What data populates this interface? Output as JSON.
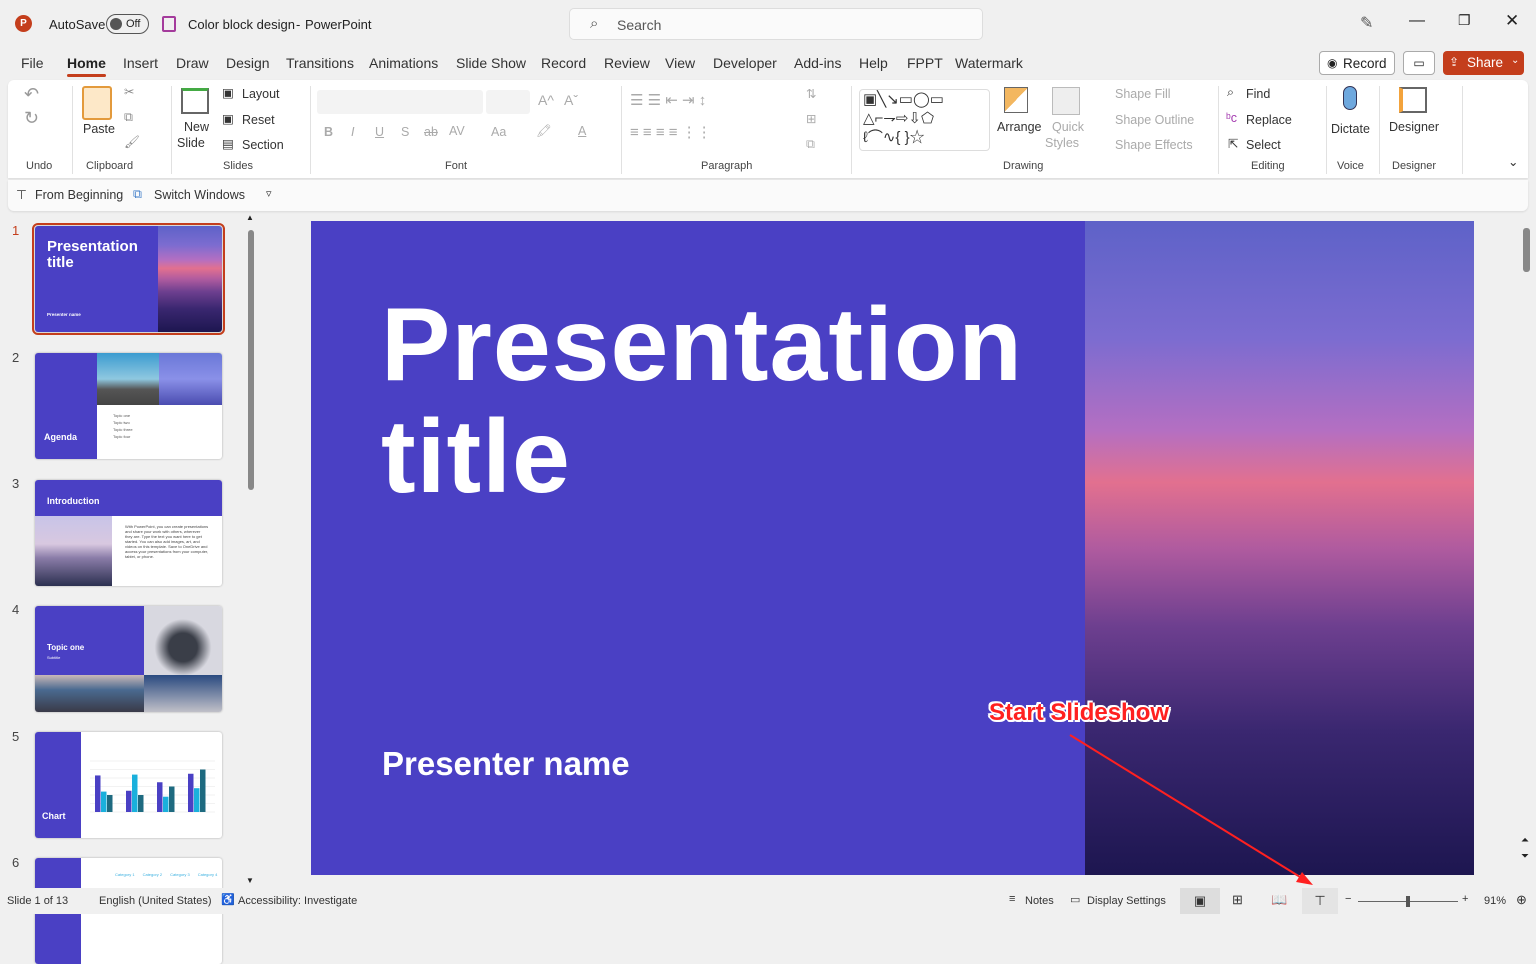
{
  "titlebar": {
    "autosave_label": "AutoSave",
    "autosave_state": "Off",
    "doc_title": "Color block design",
    "app_name": "PowerPoint",
    "separator": "-",
    "search_placeholder": "Search"
  },
  "tabs": [
    "File",
    "Home",
    "Insert",
    "Draw",
    "Design",
    "Transitions",
    "Animations",
    "Slide Show",
    "Record",
    "Review",
    "View",
    "Developer",
    "Add-ins",
    "Help",
    "FPPT",
    "Watermark"
  ],
  "tab_actions": {
    "record": "Record",
    "share": "Share"
  },
  "ribbon": {
    "undo_group": "Undo",
    "clipboard": {
      "paste": "Paste",
      "group": "Clipboard"
    },
    "slides": {
      "new_slide_1": "New",
      "new_slide_2": "Slide",
      "layout": "Layout",
      "reset": "Reset",
      "section": "Section",
      "group": "Slides"
    },
    "font": {
      "group": "Font",
      "bold": "B",
      "italic": "I",
      "underline": "U",
      "shadow": "S",
      "strike": "ab",
      "spacing": "AV",
      "case": "Aa",
      "grow": "A^",
      "shrink": "Aˇ"
    },
    "paragraph": {
      "group": "Paragraph"
    },
    "drawing": {
      "arrange": "Arrange",
      "quick_styles_1": "Quick",
      "quick_styles_2": "Styles",
      "shape_fill": "Shape Fill",
      "shape_outline": "Shape Outline",
      "shape_effects": "Shape Effects",
      "group": "Drawing"
    },
    "editing": {
      "find": "Find",
      "replace": "Replace",
      "select": "Select",
      "group": "Editing"
    },
    "voice": {
      "dictate": "Dictate",
      "group": "Voice"
    },
    "designer": {
      "designer": "Designer",
      "group": "Designer"
    }
  },
  "qat": {
    "from_beginning": "From Beginning",
    "switch_windows": "Switch Windows"
  },
  "thumbnails": [
    {
      "num": "1",
      "title": "Presentation title",
      "sub": "Presenter name"
    },
    {
      "num": "2",
      "title": "Agenda",
      "items": [
        "Topic one",
        "Topic two",
        "Topic three",
        "Topic four"
      ]
    },
    {
      "num": "3",
      "title": "Introduction",
      "body": "With PowerPoint, you can create presentations and share your work with others, wherever they are. Type the text you want here to get started. You can also add images, art, and videos on this template. Save to OneDrive and access your presentations from your computer, tablet, or phone."
    },
    {
      "num": "4",
      "title": "Topic one",
      "sub": "Subtitle"
    },
    {
      "num": "5",
      "title": "Chart",
      "chart_values": [
        [
          4.3,
          2.5,
          3.5,
          4.5
        ],
        [
          2.4,
          4.4,
          1.8,
          2.8
        ],
        [
          2,
          2,
          3,
          5
        ]
      ]
    },
    {
      "num": "6",
      "headers": [
        "Category 1",
        "Category 2",
        "Category 3",
        "Category 4"
      ]
    }
  ],
  "slide": {
    "title_line1": "Presentation",
    "title_line2": "title",
    "presenter": "Presenter name",
    "bg_color": "#4a40c4"
  },
  "annotation": {
    "text": "Start Slideshow",
    "color": "#ff2020"
  },
  "status": {
    "slide": "Slide 1 of 13",
    "language": "English (United States)",
    "accessibility": "Accessibility: Investigate",
    "notes": "Notes",
    "display": "Display Settings",
    "zoom": "91%",
    "zoom_level": 0.5
  }
}
